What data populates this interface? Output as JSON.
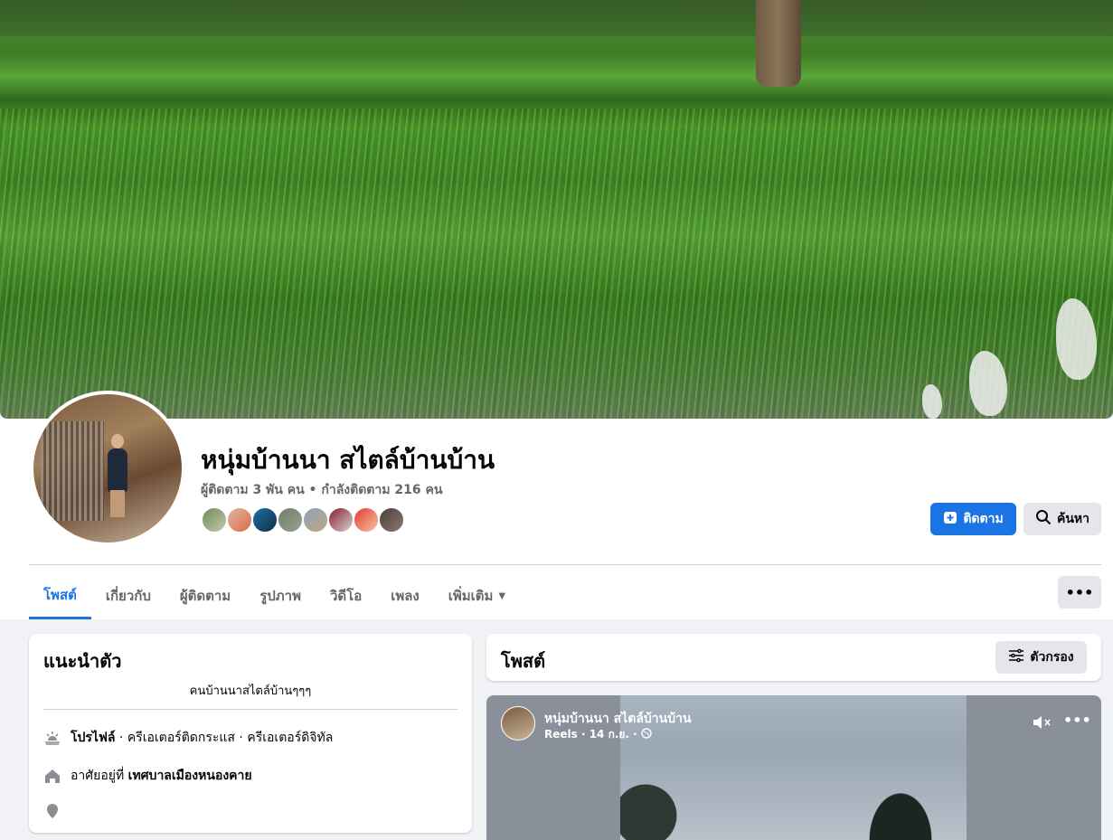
{
  "profile": {
    "name": "หนุ่มบ้านนา สไตล์บ้านบ้าน",
    "stats": "ผู้ติดตาม 3 พัน คน • กำลังติดตาม 216 คน"
  },
  "actions": {
    "follow_label": "ติดตาม",
    "search_label": "ค้นหา",
    "more_label": "•••"
  },
  "tabs": [
    {
      "label": "โพสต์"
    },
    {
      "label": "เกี่ยวกับ"
    },
    {
      "label": "ผู้ติดตาม"
    },
    {
      "label": "รูปภาพ"
    },
    {
      "label": "วิดีโอ"
    },
    {
      "label": "เพลง"
    },
    {
      "label": "เพิ่มเติม"
    }
  ],
  "intro": {
    "title": "แนะนำตัว",
    "bio": "คนบ้านนาสไตล์บ้านๆๆๆ",
    "profile_label": "โปรไฟล์",
    "profile_detail": " · ครีเอเตอร์ดิจิทัล",
    "profile_category": " · ครีเอเตอร์ติดกระแส",
    "lives_prefix": "อาศัยอยู่ที่ ",
    "lives_place": "เทศบาลเมืองหนองคาย"
  },
  "posts": {
    "title": "โพสต์",
    "filter_label": "ตัวกรอง"
  },
  "reel": {
    "author": "หนุ่มบ้านนา สไตล์บ้านบ้าน",
    "meta": "Reels · 14 ก.ย. ·",
    "more_label": "•••"
  },
  "colors": {
    "accent": "#1b74e4",
    "secondary_button": "#e4e6eb",
    "background": "#f0f2f5"
  }
}
